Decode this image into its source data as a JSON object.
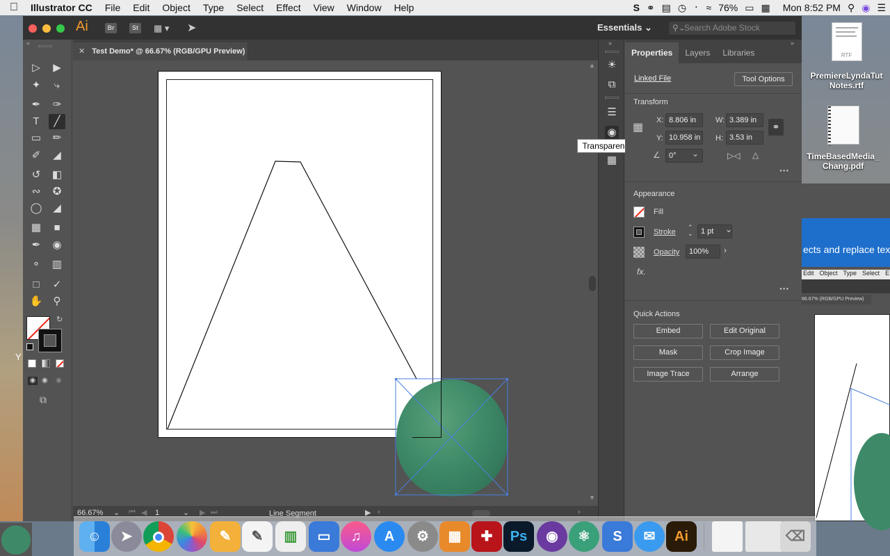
{
  "menubar": {
    "app": "Illustrator CC",
    "items": [
      "File",
      "Edit",
      "Object",
      "Type",
      "Select",
      "Effect",
      "View",
      "Window",
      "Help"
    ],
    "battery": "76%",
    "clock": "Mon 8:52 PM"
  },
  "titlebar": {
    "ai": "Ai",
    "br": "Br",
    "st": "St",
    "workspace": "Essentials",
    "search_placeholder": "Search Adobe Stock"
  },
  "document": {
    "tab_title": "Test Demo* @ 66.67% (RGB/GPU Preview)"
  },
  "status": {
    "zoom": "66.67%",
    "page": "1",
    "tool": "Line Segment"
  },
  "tooltip": "Transparency",
  "properties": {
    "tabs": [
      "Properties",
      "Layers",
      "Libraries"
    ],
    "linked_file": "Linked File",
    "tool_options": "Tool Options",
    "transform_title": "Transform",
    "x_label": "X:",
    "x_value": "8.806 in",
    "y_label": "Y:",
    "y_value": "10.958 in",
    "w_label": "W:",
    "w_value": "3.389 in",
    "h_label": "H:",
    "h_value": "3.53 in",
    "angle_value": "0°",
    "appearance_title": "Appearance",
    "fill_label": "Fill",
    "stroke_label": "Stroke",
    "stroke_value": "1 pt",
    "opacity_label": "Opacity",
    "opacity_value": "100%",
    "fx": "fx.",
    "quick_actions_title": "Quick Actions",
    "actions": [
      "Embed",
      "Edit Original",
      "Mask",
      "Crop Image",
      "Image Trace",
      "Arrange"
    ]
  },
  "desktop": {
    "file1": "PremiereLyndaTut Notes.rtf",
    "file1_badge": "RTF",
    "file2": "TimeBasedMedia_ Chang.pdf",
    "snippet": "ects and replace text",
    "mini_menu": [
      "Edit",
      "Object",
      "Type",
      "Select",
      "E"
    ],
    "mini_tab": "66.67% (RGB/GPU Preview)",
    "edge_letter": "Y"
  },
  "dock": {
    "illustrator_label": "Ai",
    "photoshop_label": "Ps"
  },
  "colors": {
    "ai_orange": "#f29a2e",
    "selection_blue": "#4a7fe0",
    "beanbag_green": "#3e8a68"
  }
}
